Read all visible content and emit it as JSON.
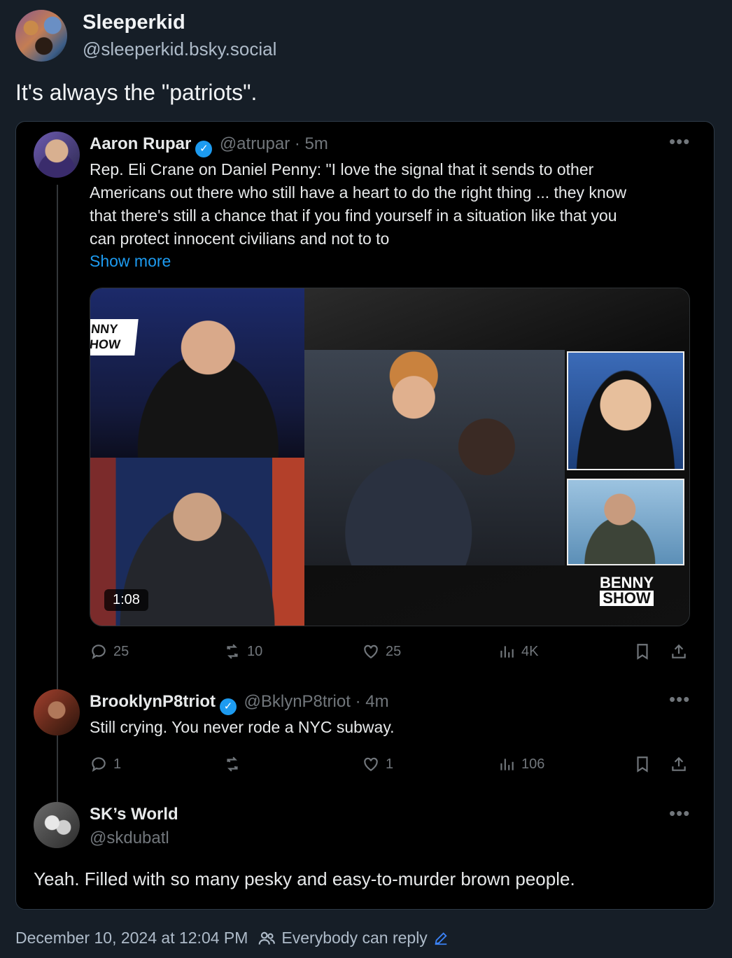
{
  "post": {
    "author_name": "Sleeperkid",
    "author_handle": "@sleeperkid.bsky.social",
    "text": "It's always the \"patriots\".",
    "timestamp": "December 10, 2024 at 12:04 PM",
    "reply_setting": "Everybody can reply"
  },
  "embed": {
    "tweet1": {
      "name": "Aaron Rupar",
      "meta": "@atrupar · 5m",
      "lines": [
        "Rep. Eli Crane on Daniel Penny: \"I love the signal that it sends to other",
        "Americans out there who still have a heart to do the right thing ... they know",
        "that there's still a chance that if you find yourself in a situation like that you",
        "can protect innocent civilians and not to to"
      ],
      "show_more": "Show more",
      "video_duration": "1:08",
      "logo_left": "NNY\nHOW",
      "logo_right_top": "BENNY",
      "logo_right_bottom": "SHOW",
      "replies": "25",
      "reposts": "10",
      "likes": "25",
      "views": "4K"
    },
    "tweet2": {
      "name": "BrooklynP8triot",
      "meta": "@BklynP8triot · 4m",
      "text": "Still crying. You never rode a NYC subway.",
      "replies": "1",
      "reposts": "",
      "likes": "1",
      "views": "106"
    },
    "tweet3": {
      "name": "SK’s World",
      "handle": "@skdubatl",
      "text": "Yeah.  Filled with so many pesky and easy-to-murder brown people."
    }
  },
  "colors": {
    "background": "#161e27",
    "link": "#1d9bf0",
    "muted": "#71767b",
    "footer_text": "#aebbc9"
  }
}
